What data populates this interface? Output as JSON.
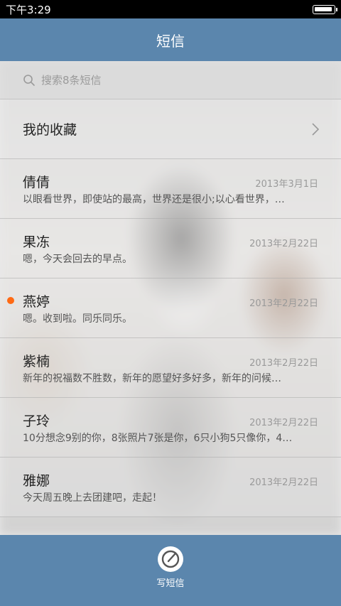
{
  "status": {
    "time": "下午3:29",
    "battery_level": 0.85
  },
  "title": "短信",
  "search": {
    "placeholder": "搜索8条短信"
  },
  "favorites": {
    "label": "我的收藏"
  },
  "conversations": [
    {
      "name": "倩倩",
      "date": "2013年3月1日",
      "preview": "以眼看世界，即使站的最高，世界还是很小;以心看世界，…",
      "unread": false
    },
    {
      "name": "果冻",
      "date": "2013年2月22日",
      "preview": "嗯，今天会回去的早点。",
      "unread": false
    },
    {
      "name": "燕婷",
      "date": "2013年2月22日",
      "preview": "嗯。收到啦。同乐同乐。",
      "unread": true
    },
    {
      "name": "紫楠",
      "date": "2013年2月22日",
      "preview": "新年的祝福数不胜数，新年的愿望好多好多，新年的问候…",
      "unread": false
    },
    {
      "name": "子玲",
      "date": "2013年2月22日",
      "preview": "10分想念9别的你，8张照片7张是你，6只小狗5只像你，4…",
      "unread": false
    },
    {
      "name": "雅娜",
      "date": "2013年2月22日",
      "preview": "今天周五晚上去团建吧，走起！",
      "unread": false
    }
  ],
  "compose": {
    "label": "写短信"
  },
  "colors": {
    "accent": "#5b86ad",
    "unread_dot": "#ff6a14"
  }
}
